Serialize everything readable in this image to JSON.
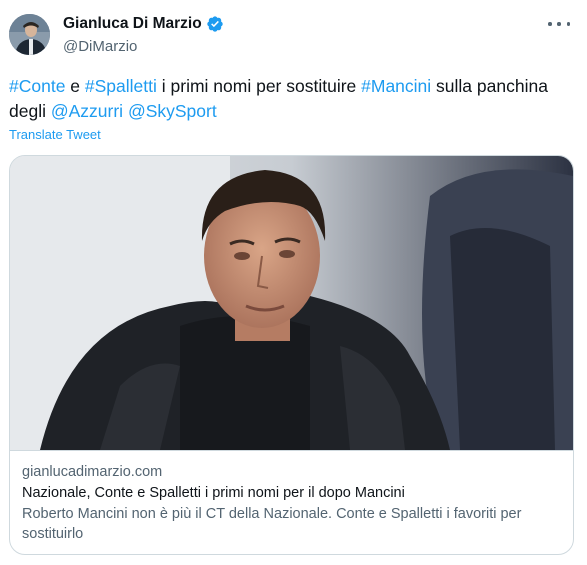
{
  "author": {
    "display_name": "Gianluca Di Marzio",
    "handle": "@DiMarzio"
  },
  "tweet": {
    "segments": [
      {
        "text": "#Conte",
        "type": "hashtag"
      },
      {
        "text": " e ",
        "type": "text"
      },
      {
        "text": "#Spalletti",
        "type": "hashtag"
      },
      {
        "text": " i primi nomi per sostituire ",
        "type": "text"
      },
      {
        "text": "#Mancini",
        "type": "hashtag"
      },
      {
        "text": " sulla panchina degli ",
        "type": "text"
      },
      {
        "text": "@Azzurri",
        "type": "mention"
      },
      {
        "text": " ",
        "type": "text"
      },
      {
        "text": "@SkySport",
        "type": "mention"
      }
    ],
    "translate_label": "Translate Tweet"
  },
  "card": {
    "domain": "gianlucadimarzio.com",
    "title": "Nazionale, Conte e Spalletti i primi nomi per il dopo Mancini",
    "description": "Roberto Mancini non è più il CT della Nazionale. Conte e Spalletti i favoriti per sostituirlo"
  },
  "colors": {
    "link": "#1d9bf0",
    "verified": "#1d9bf0",
    "secondary_text": "#536471",
    "border": "#cfd9de"
  },
  "icons": {
    "verified": "verified-badge-icon",
    "more": "more-options-icon"
  }
}
